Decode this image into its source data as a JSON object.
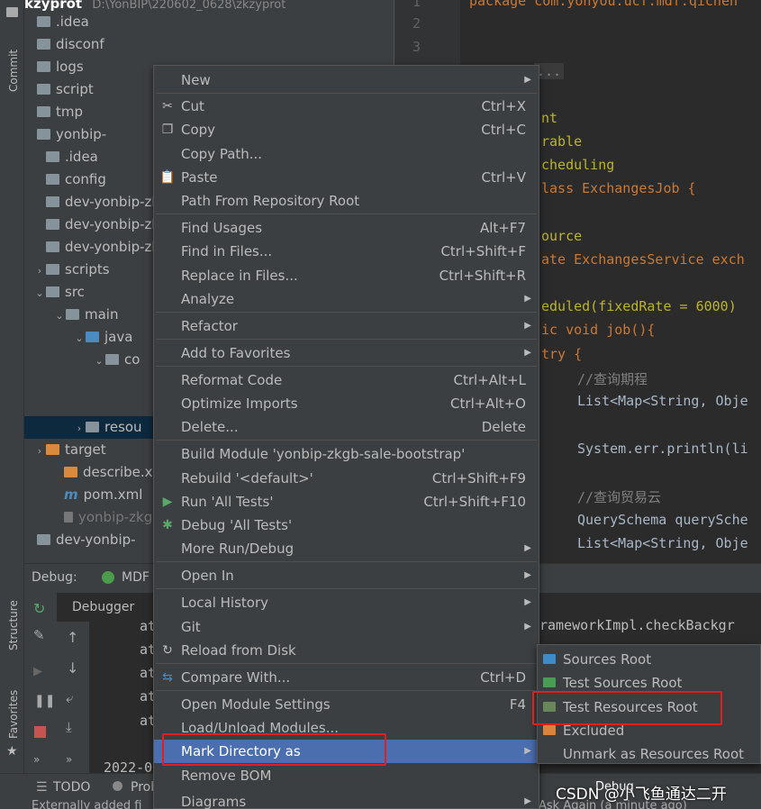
{
  "project": {
    "root_name": "kzyprot",
    "root_path": "D:\\YonBIP\\220602_0628\\zkzyprot",
    "tree_items": [
      ".idea",
      "disconf",
      "logs",
      "script",
      "tmp",
      "yonbip-",
      ".idea",
      "config",
      "dev-yonbip-zkg",
      "dev-yonbip-zkg",
      "dev-yonbip-zkg",
      "scripts",
      "src",
      "main",
      "java",
      "co",
      "resou",
      "target",
      "describe.xm",
      "pom.xml",
      "yonbip-zkgl",
      "dev-yonbip-"
    ]
  },
  "left_strip": {
    "commit": "Commit",
    "structure": "Structure",
    "favorites": "Favorites"
  },
  "editor": {
    "line_numbers": [
      "1",
      "2",
      "3"
    ],
    "lines": [
      "package com.yonyou.ucf.mdf.qichen",
      "...",
      "nt",
      "rable",
      "cheduling",
      "lass ExchangesJob {",
      "ource",
      "ate ExchangesService exch",
      "eduled(fixedRate = 6000)",
      "ic void job(){",
      "try {",
      "//查询期程",
      "List<Map<String, Obje",
      "System.err.println(li",
      "//查询贸易云",
      "QuerySchema querySche",
      "List<Map<String, Obje"
    ]
  },
  "debug": {
    "tab_label": "Debug:",
    "config_name": "MDF",
    "debugger_tab": "Debugger",
    "frames": [
      "at",
      "at",
      "at",
      "at",
      "at"
    ],
    "log_text": "2022-0",
    "right_text_1": "rameworkImpl.checkBackgr",
    "right_text_2": "Ask Again (a minute ago)"
  },
  "status": {
    "todo": "TODO",
    "problems": "Prob",
    "debug": "Debug",
    "bottom_text": "Externally added fi"
  },
  "context_menu": {
    "items": [
      {
        "label": "New",
        "shortcut": "",
        "submenu": true
      },
      {
        "label": "Cut",
        "shortcut": "Ctrl+X",
        "icon": "scissors-icon"
      },
      {
        "label": "Copy",
        "shortcut": "Ctrl+C",
        "icon": "copy-icon"
      },
      {
        "label": "Copy Path...",
        "shortcut": ""
      },
      {
        "label": "Paste",
        "shortcut": "Ctrl+V",
        "icon": "paste-icon"
      },
      {
        "label": "Path From Repository Root",
        "shortcut": ""
      },
      {
        "label": "Find Usages",
        "shortcut": "Alt+F7"
      },
      {
        "label": "Find in Files...",
        "shortcut": "Ctrl+Shift+F"
      },
      {
        "label": "Replace in Files...",
        "shortcut": "Ctrl+Shift+R"
      },
      {
        "label": "Analyze",
        "shortcut": "",
        "submenu": true
      },
      {
        "label": "Refactor",
        "shortcut": "",
        "submenu": true
      },
      {
        "label": "Add to Favorites",
        "shortcut": "",
        "submenu": true
      },
      {
        "label": "Reformat Code",
        "shortcut": "Ctrl+Alt+L"
      },
      {
        "label": "Optimize Imports",
        "shortcut": "Ctrl+Alt+O"
      },
      {
        "label": "Delete...",
        "shortcut": "Delete"
      },
      {
        "label": "Build Module 'yonbip-zkgb-sale-bootstrap'",
        "shortcut": ""
      },
      {
        "label": "Rebuild '<default>'",
        "shortcut": "Ctrl+Shift+F9"
      },
      {
        "label": "Run 'All Tests'",
        "shortcut": "Ctrl+Shift+F10",
        "icon": "run-icon"
      },
      {
        "label": "Debug 'All Tests'",
        "shortcut": "",
        "icon": "bug-icon"
      },
      {
        "label": "More Run/Debug",
        "shortcut": "",
        "submenu": true
      },
      {
        "label": "Open In",
        "shortcut": "",
        "submenu": true
      },
      {
        "label": "Local History",
        "shortcut": "",
        "submenu": true
      },
      {
        "label": "Git",
        "shortcut": "",
        "submenu": true
      },
      {
        "label": "Reload from Disk",
        "shortcut": "",
        "icon": "reload-icon"
      },
      {
        "label": "Compare With...",
        "shortcut": "Ctrl+D",
        "icon": "compare-icon"
      },
      {
        "label": "Open Module Settings",
        "shortcut": "F4"
      },
      {
        "label": "Load/Unload Modules...",
        "shortcut": ""
      },
      {
        "label": "Mark Directory as",
        "shortcut": "",
        "submenu": true
      },
      {
        "label": "Remove BOM",
        "shortcut": ""
      },
      {
        "label": "Diagrams",
        "shortcut": "",
        "submenu": true
      }
    ]
  },
  "submenu": {
    "items": [
      {
        "label": "Sources Root",
        "color": "#3d8bc7"
      },
      {
        "label": "Test Sources Root",
        "color": "#499c54"
      },
      {
        "label": "Test Resources Root",
        "color": "#6a8759"
      },
      {
        "label": "Excluded",
        "color": "#d9833c"
      },
      {
        "label": "Unmark as Resources Root",
        "color": ""
      }
    ]
  },
  "watermark": "CSDN @小飞鱼通达二开",
  "colors": {
    "highlight": "#4b6eaf",
    "annotation_red": "#e02020"
  }
}
